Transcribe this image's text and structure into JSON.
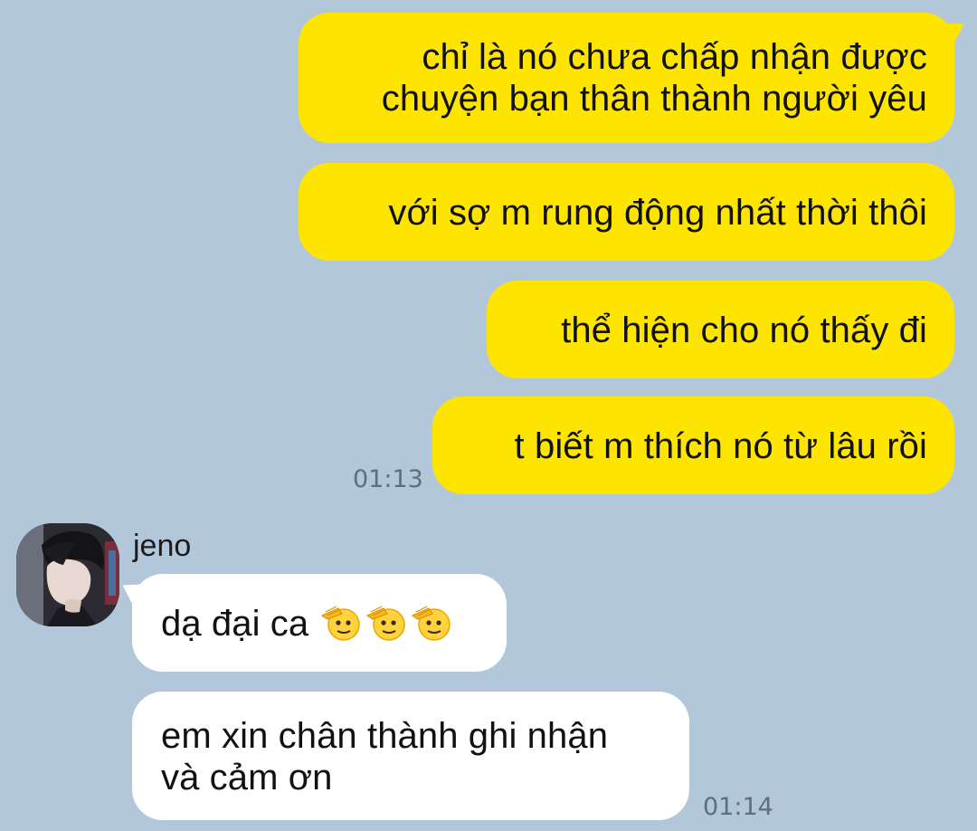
{
  "conversation": {
    "outgoing": [
      {
        "text": "chỉ là nó chưa chấp nhận được\nchuyện bạn thân thành người yêu"
      },
      {
        "text": "với sợ m rung động nhất thời thôi"
      },
      {
        "text": "thể hiện cho nó thấy đi"
      },
      {
        "text": "t biết m thích nó từ lâu rồi"
      }
    ],
    "outgoing_time": "01:13",
    "sender": {
      "name": "jeno",
      "avatar_icon": "profile-photo"
    },
    "incoming": [
      {
        "text": "dạ đại ca",
        "emoji_icon": "saluting-face-emoji",
        "emoji_count": 3
      },
      {
        "text": "em xin chân thành ghi nhận\nvà cảm ơn"
      }
    ],
    "incoming_time": "01:14"
  },
  "colors": {
    "background": "#b2c7da",
    "outgoing_bubble": "#fee500",
    "incoming_bubble": "#ffffff",
    "timestamp": "#5e6e7c"
  }
}
